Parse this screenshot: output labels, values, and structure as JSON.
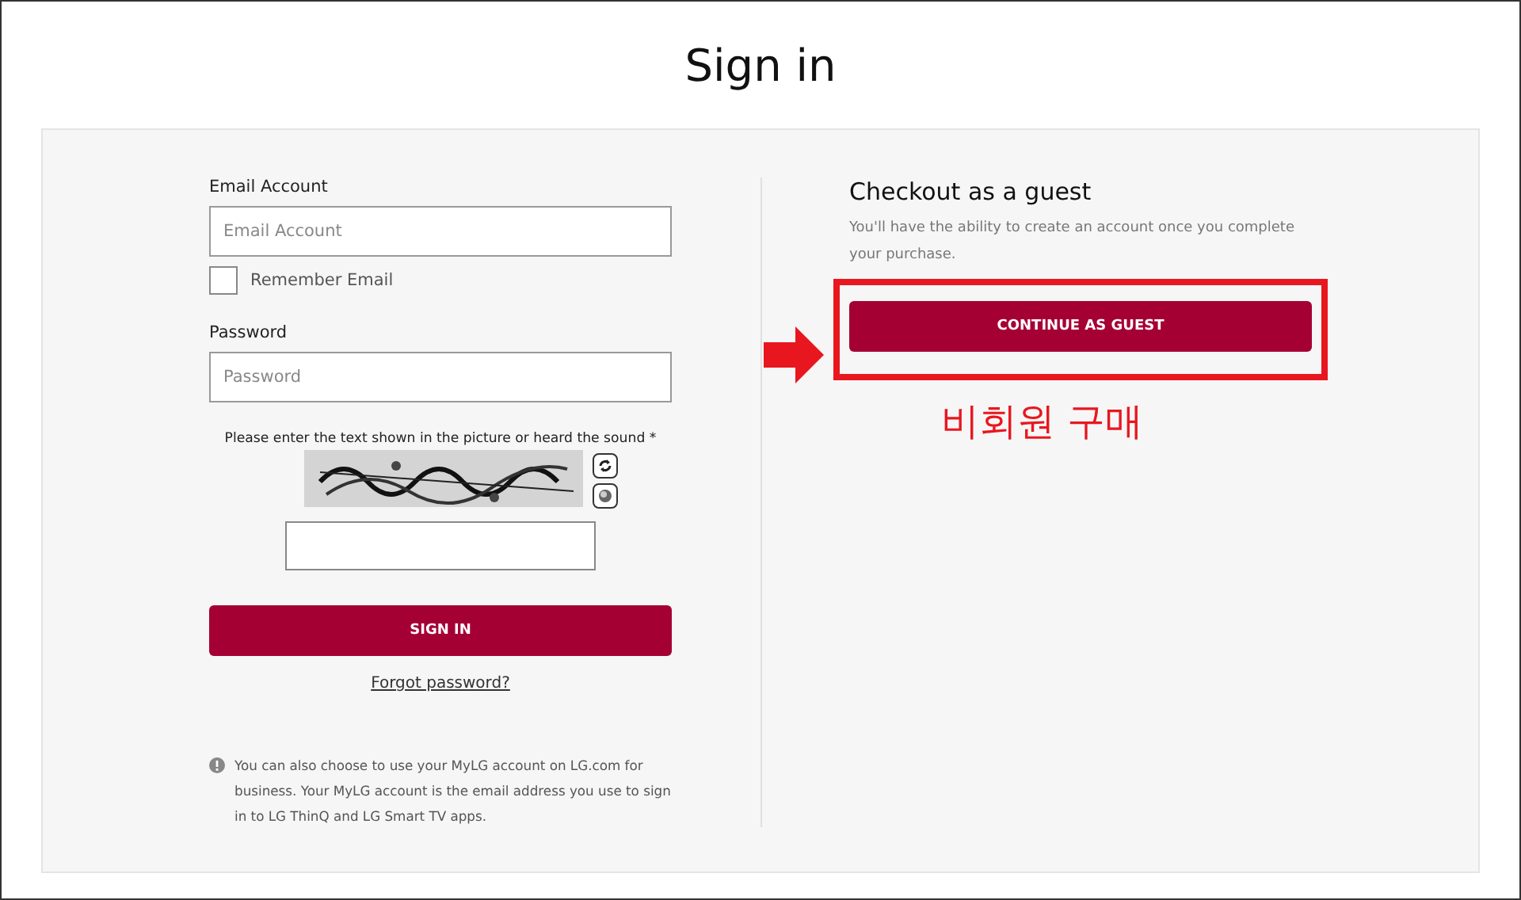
{
  "page": {
    "title": "Sign in"
  },
  "login": {
    "email_label": "Email Account",
    "email_placeholder": "Email Account",
    "remember": {
      "label": "Remember Email",
      "checked": false
    },
    "password_label": "Password",
    "password_placeholder": "Password",
    "captcha_prompt": "Please enter the text shown in the picture or heard the sound *",
    "sign_in": "SIGN IN",
    "forgot": "Forgot password?",
    "note": "You can also choose to use your MyLG account on LG.com for business. Your MyLG account is the email address you use to sign in to LG ThinQ and LG Smart TV apps."
  },
  "guest": {
    "title": "Checkout as a guest",
    "text": "You'll have the ability to create an account once you complete your purchase.",
    "button": "CONTINUE AS GUEST"
  },
  "annotation": {
    "label": "비회원 구매"
  }
}
